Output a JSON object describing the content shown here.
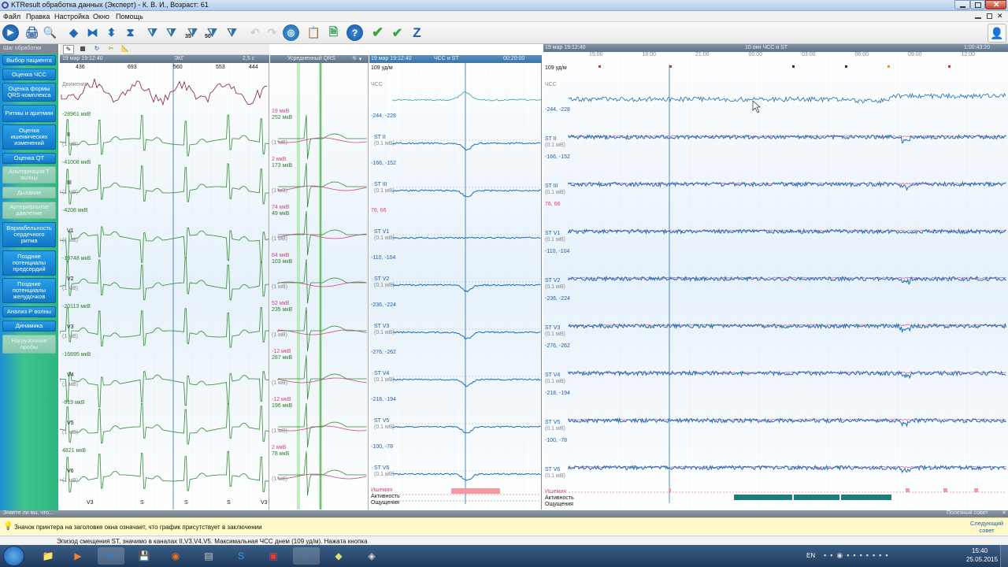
{
  "window": {
    "title": "KTResult обработка данных (Эксперт) - К. В. И., Возраст: 61"
  },
  "menu": [
    "Файл",
    "Правка",
    "Настройка",
    "Окно",
    "Помощь"
  ],
  "toolbar": {
    "filter35": "35",
    "filter50": "50",
    "z": "Z"
  },
  "sidebar": {
    "header": "Шаг обработки",
    "items": [
      {
        "label": "Выбор пациента",
        "enabled": true
      },
      {
        "label": "Оценка ЧСС",
        "enabled": true
      },
      {
        "label": "Оценка формы QRS-комплекса",
        "enabled": true
      },
      {
        "label": "Ритмы и аритмии",
        "enabled": true
      },
      {
        "label": "Оценка ишемических изменений",
        "enabled": true
      },
      {
        "label": "Оценка QT",
        "enabled": true
      },
      {
        "label": "Альтернация Т волны",
        "enabled": false
      },
      {
        "label": "Дыхание",
        "enabled": false
      },
      {
        "label": "Артериальное давление",
        "enabled": false
      },
      {
        "label": "Вариабельность сердечного ритма",
        "enabled": true
      },
      {
        "label": "Поздние потенциалы предсердий",
        "enabled": true
      },
      {
        "label": "Поздние потенциалы желудочков",
        "enabled": true
      },
      {
        "label": "Анализ Р волны",
        "enabled": true
      },
      {
        "label": "Динамика",
        "enabled": true
      },
      {
        "label": "Нагрузочные пробы",
        "enabled": false
      }
    ]
  },
  "ecg": {
    "header_date": "19 мар 19:12:40",
    "header_title": "ЭКГ",
    "header_speed": "2,5 с",
    "rr": [
      "436",
      "693",
      "560",
      "553",
      "444"
    ],
    "motion_label": "Движение",
    "leads": [
      {
        "name": "II",
        "val": "-28961 мкВ",
        "scale": "(1 мВ)"
      },
      {
        "name": "III",
        "val": "-41008 мкВ",
        "scale": "(1 мВ)"
      },
      {
        "name": "V1",
        "val": "-4208 мкВ",
        "scale": "(1 мВ)"
      },
      {
        "name": "V2",
        "val": "-19748 мкВ",
        "scale": "(1 мВ)"
      },
      {
        "name": "V3",
        "val": "-20113 мкВ",
        "scale": "(1 мВ)"
      },
      {
        "name": "V4",
        "val": "-16695 мкВ",
        "scale": "(1 мВ)"
      },
      {
        "name": "V5",
        "val": "-619 мкВ",
        "scale": "(1 мВ)"
      },
      {
        "name": "V6",
        "val": "4821 мкВ",
        "scale": "(1 мВ)"
      }
    ],
    "beat_labels": [
      "V3",
      "S",
      "S",
      "S",
      "V3"
    ]
  },
  "qrs": {
    "header_title": "Усредненный QRS",
    "rows": [
      {
        "pink": "19 мкВ",
        "green": "252 мкВ",
        "scale": "(1 мВ)"
      },
      {
        "pink": "2 мкВ",
        "green": "173 мкВ",
        "scale": "(1 мВ)"
      },
      {
        "pink": "74 мкВ",
        "green": "49 мкВ",
        "scale": "(1 мВ)"
      },
      {
        "pink": "64 мкВ",
        "green": "103 мкВ",
        "scale": "(1 мВ)"
      },
      {
        "pink": "52 мкВ",
        "green": "235 мкВ",
        "scale": "(1 мВ)"
      },
      {
        "pink": "-12 мкВ",
        "green": "287 мкВ",
        "scale": "(1 мВ)"
      },
      {
        "pink": "-12 мкВ",
        "green": "196 мкВ",
        "scale": "(1 мВ)"
      },
      {
        "pink": "2 мкВ",
        "green": "78 мкВ",
        "scale": "(1 мВ)"
      }
    ]
  },
  "hrst_zoom": {
    "header_date": "19 мар 19:12:40",
    "header_title": "ЧСС и ST",
    "header_span": "00:20:00",
    "hr_top": "109 уд/м",
    "hr_label": "ЧСС",
    "rows": [
      {
        "range": "-244, -228",
        "lead": "ST II",
        "scale": "(0.1 мВ)",
        "pink": false
      },
      {
        "range": "-166, -152",
        "lead": "ST III",
        "scale": "(0.1 мВ)",
        "pink": false
      },
      {
        "range": "76, 66",
        "lead": "ST V1",
        "scale": "(0.1 мВ)",
        "pink": true
      },
      {
        "range": "-110, -104",
        "lead": "ST V2",
        "scale": "(0.1 мВ)",
        "pink": false
      },
      {
        "range": "-236, -224",
        "lead": "ST V3",
        "scale": "(0.1 мВ)",
        "pink": false
      },
      {
        "range": "-276, -262",
        "lead": "ST V4",
        "scale": "(0.1 мВ)",
        "pink": false
      },
      {
        "range": "-218, -194",
        "lead": "ST V5",
        "scale": "(0.1 мВ)",
        "pink": false
      },
      {
        "range": "-100, -78",
        "lead": "ST V6",
        "scale": "(0.1 мВ)",
        "pink": false
      }
    ],
    "bottom_labels": [
      "Ишемия",
      "Активность",
      "Ощущения"
    ]
  },
  "hrst_overview": {
    "header_date": "19 мар 19:12:40",
    "header_title": "10 окн ЧСС и ST",
    "header_end": "1:00:43:20",
    "times": [
      "15:00",
      "18:00",
      "21:00",
      "00:00",
      "03:00",
      "06:00",
      "09:00",
      "12:00"
    ],
    "hr_top": "109 уд/м",
    "hr_label": "ЧСС"
  },
  "bottom_bar": {
    "left": "Знаете ли вы, что...",
    "right": "Полезный совет"
  },
  "hint": {
    "text": "Значок принтера на заголовке окна означает, что график присутствует в заключении",
    "next": "Следующий совет"
  },
  "status": {
    "text": "Эпизод смещения ST, значимо в каналах II,V3,V4,V5. Максимальная ЧСС днем (109 уд/м). Нажата кнопка"
  },
  "taskbar": {
    "lang": "EN",
    "time": "15:40",
    "date": "25.05.2015"
  },
  "colors": {
    "sidebar_btn": "#1177c8",
    "trace_green": "#2e8b2e",
    "trace_blue": "#1e6fb0",
    "pink": "#d0468a",
    "hint_bg": "#fff9c9"
  }
}
